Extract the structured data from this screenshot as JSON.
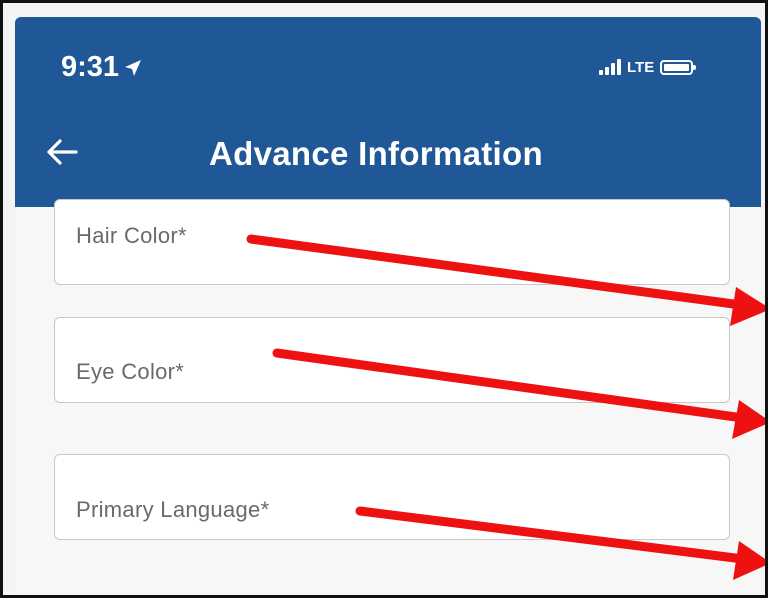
{
  "status_bar": {
    "time": "9:31",
    "network": "LTE"
  },
  "header": {
    "title": "Advance Information"
  },
  "form": {
    "fields": [
      {
        "label": "Hair Color*"
      },
      {
        "label": "Eye Color*"
      },
      {
        "label": "Primary Language*"
      }
    ]
  },
  "colors": {
    "header_bg": "#1f5797",
    "annotation_arrow": "#ee1111",
    "field_border": "#c8c8c8",
    "label_text": "#6a6a6a"
  },
  "icons": {
    "back": "arrow-left-icon",
    "location": "location-arrow-icon",
    "signal": "signal-bars-icon",
    "battery": "battery-icon"
  }
}
